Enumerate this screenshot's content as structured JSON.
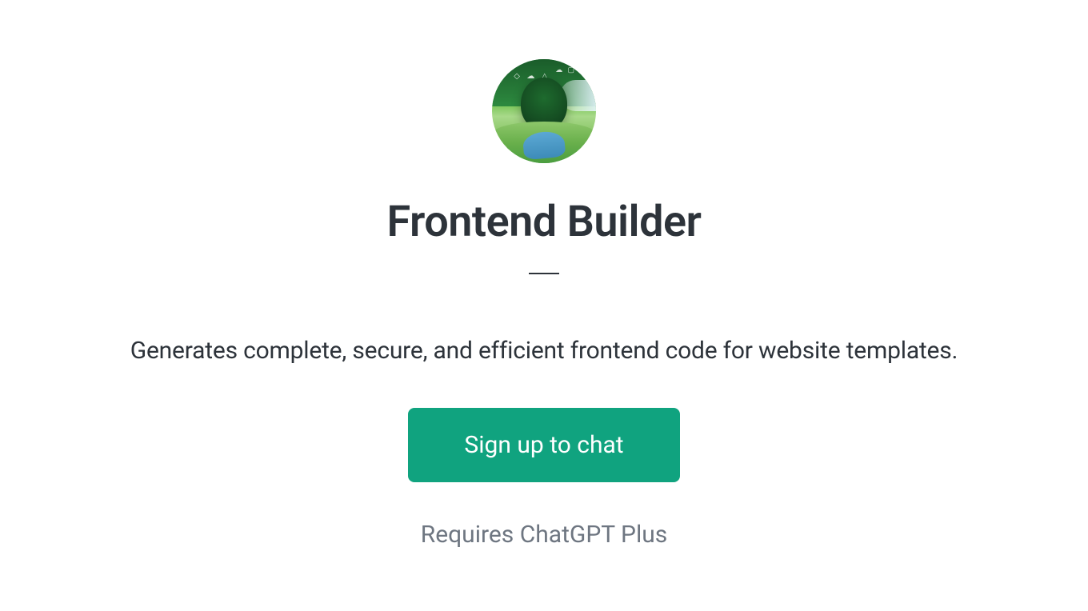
{
  "header": {
    "title": "Frontend Builder"
  },
  "main": {
    "description": "Generates complete, secure, and efficient frontend code for website templates.",
    "cta_label": "Sign up to chat",
    "requirement": "Requires ChatGPT Plus"
  },
  "colors": {
    "accent": "#10a37f",
    "text_primary": "#2d333a",
    "text_secondary": "#6e7681"
  }
}
